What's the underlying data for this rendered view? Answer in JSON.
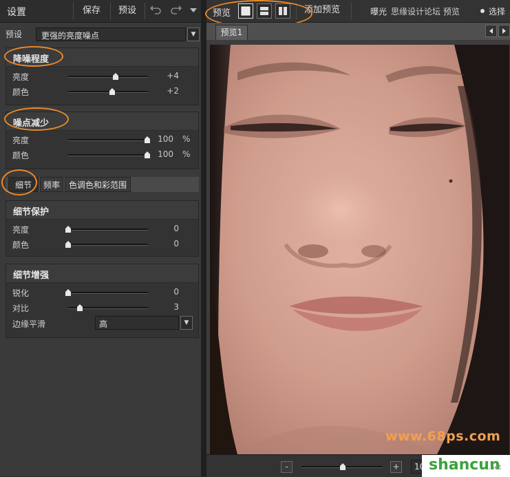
{
  "toolbar": {
    "title": "设置",
    "save_label": "保存",
    "preset_label": "预设",
    "undo_icon": "undo-icon",
    "redo_icon": "redo-icon",
    "menu_icon": "chevron-down-icon"
  },
  "preset": {
    "label": "预设",
    "value": "更强的亮度噪点"
  },
  "noise_amount": {
    "title": "降噪程度",
    "rows": [
      {
        "label": "亮度",
        "value": "+4"
      },
      {
        "label": "颜色",
        "value": "+2"
      }
    ]
  },
  "speckle_reduction": {
    "title": "噪点减少",
    "rows": [
      {
        "label": "亮度",
        "value": "100",
        "unit": "%"
      },
      {
        "label": "颜色",
        "value": "100",
        "unit": "%"
      }
    ]
  },
  "tabs": [
    "细节",
    "频率",
    "色调色和彩范围"
  ],
  "detail_protection": {
    "title": "细节保护",
    "rows": [
      {
        "label": "亮度",
        "value": "0"
      },
      {
        "label": "颜色",
        "value": "0"
      }
    ]
  },
  "detail_enhance": {
    "title": "细节增强",
    "rows": [
      {
        "label": "锐化",
        "value": "0"
      },
      {
        "label": "对比",
        "value": "3"
      }
    ],
    "edge_label": "边缘平滑",
    "edge_value": "高"
  },
  "right_toolbar": {
    "preview_label": "预览",
    "add_preview_label": "添加预览",
    "exposure_label": "曝光",
    "overflow_text": "思缘设计论坛 预览",
    "select_label": "选择"
  },
  "preview_tab": "预览1",
  "bottom": {
    "minus_label": "-",
    "plus_label": "+",
    "zoom_text": "10"
  },
  "watermarks": {
    "site": "www.68ps.com",
    "brand": "shancun",
    "brand_sub": ".net"
  },
  "colors": {
    "highlight": "#ec8a2a",
    "panel": "#3a3a3a"
  }
}
